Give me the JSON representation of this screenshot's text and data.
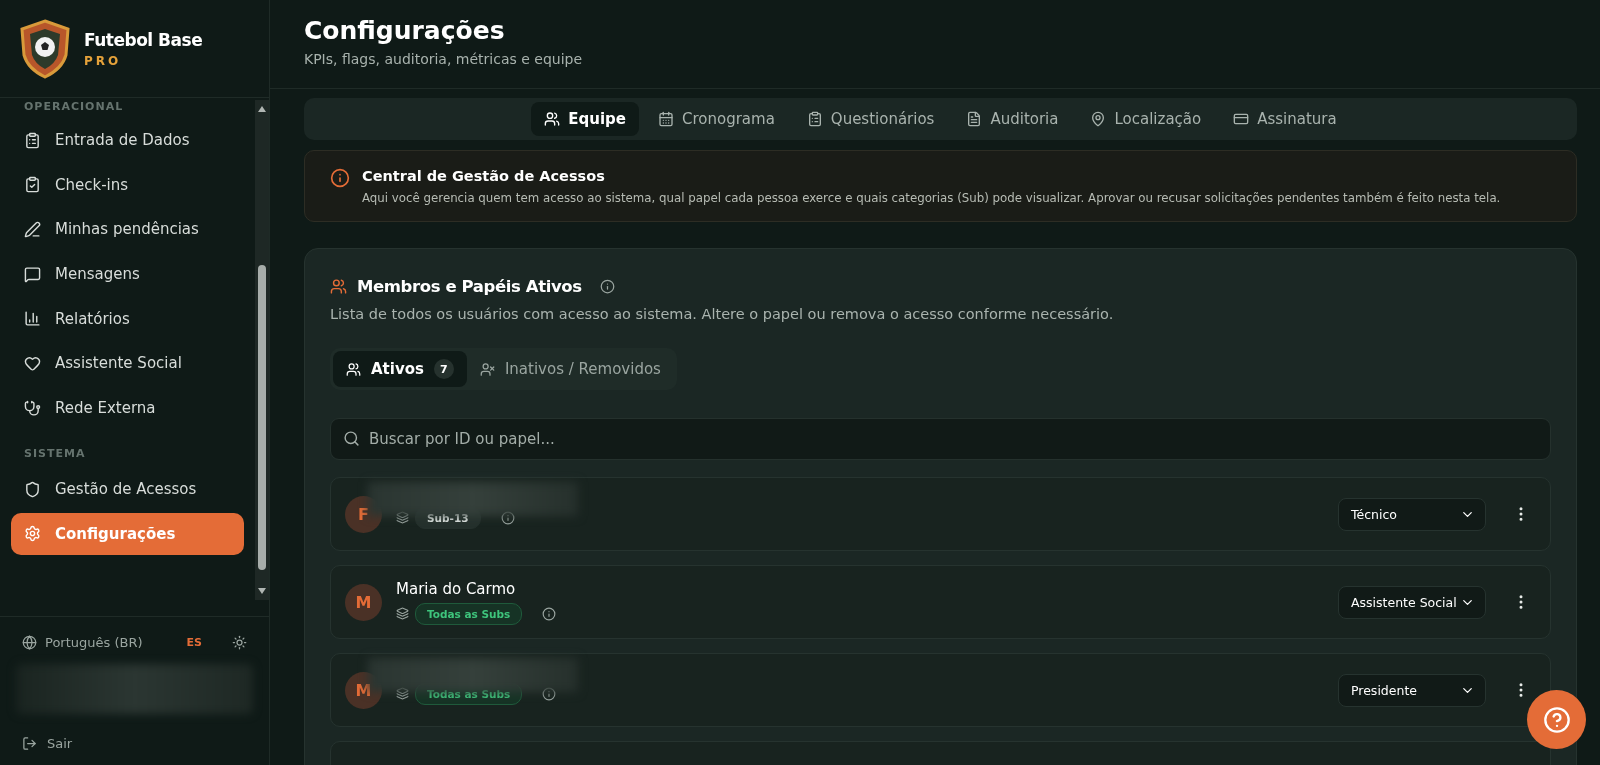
{
  "brand": {
    "name": "Futebol Base",
    "tier": "PRO"
  },
  "sidebar": {
    "sections": [
      {
        "heading": "OPERACIONAL",
        "items": [
          {
            "label": "Entrada de Dados",
            "selected": false
          },
          {
            "label": "Check-ins",
            "selected": false
          },
          {
            "label": "Minhas pendências",
            "selected": false
          },
          {
            "label": "Mensagens",
            "selected": false
          },
          {
            "label": "Relatórios",
            "selected": false
          },
          {
            "label": "Assistente Social",
            "selected": false
          },
          {
            "label": "Rede Externa",
            "selected": false
          }
        ]
      },
      {
        "heading": "SISTEMA",
        "items": [
          {
            "label": "Gestão de Acessos",
            "selected": false
          },
          {
            "label": "Configurações",
            "selected": true
          }
        ]
      }
    ],
    "language": "Português (BR)",
    "alt_language": "ES",
    "logout": "Sair"
  },
  "header": {
    "title": "Configurações",
    "subtitle": "KPIs, flags, auditoria, métricas e equipe"
  },
  "tabs": [
    {
      "label": "Equipe",
      "selected": true
    },
    {
      "label": "Cronograma",
      "selected": false
    },
    {
      "label": "Questionários",
      "selected": false
    },
    {
      "label": "Auditoria",
      "selected": false
    },
    {
      "label": "Localização",
      "selected": false
    },
    {
      "label": "Assinatura",
      "selected": false
    }
  ],
  "notice": {
    "title": "Central de Gestão de Acessos",
    "text": "Aqui você gerencia quem tem acesso ao sistema, qual papel cada pessoa exerce e quais categorias (Sub) pode visualizar. Aprovar ou recusar solicitações pendentes também é feito nesta tela."
  },
  "members": {
    "title": "Membros e Papéis Ativos",
    "description": "Lista de todos os usuários com acesso ao sistema. Altere o papel ou remova o acesso conforme necessário.",
    "filter_tabs": [
      {
        "label": "Ativos",
        "count": "7",
        "selected": true
      },
      {
        "label": "Inativos / Removidos",
        "selected": false
      }
    ],
    "search": {
      "placeholder": "Buscar por ID ou papel..."
    },
    "rows": [
      {
        "initial": "F",
        "tag": {
          "kind": "single",
          "label": "Sub-13"
        },
        "role": "Técnico"
      },
      {
        "initial": "M",
        "name": "Maria do Carmo",
        "tag": {
          "kind": "all",
          "label": "Todas as Subs"
        },
        "role": "Assistente Social"
      },
      {
        "initial": "M",
        "tag": {
          "kind": "all",
          "label": "Todas as Subs"
        },
        "role": "Presidente"
      }
    ]
  }
}
